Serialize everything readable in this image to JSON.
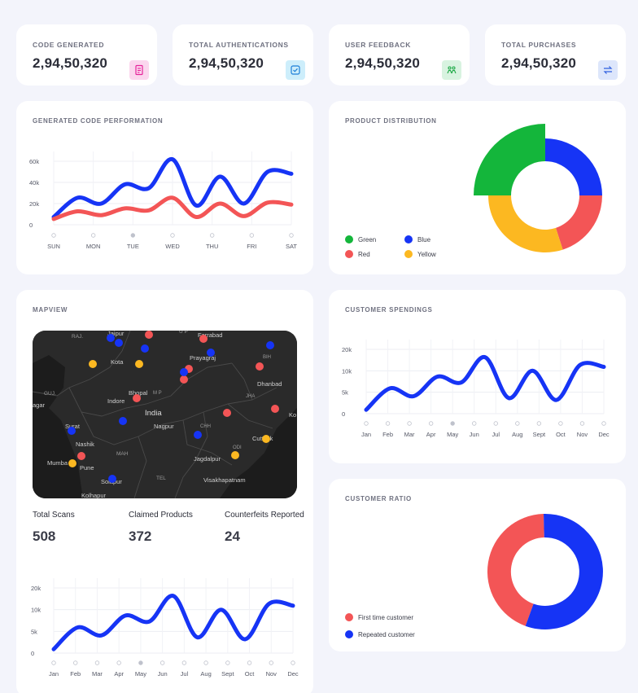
{
  "kpis": [
    {
      "label": "CODE GENERATED",
      "value": "2,94,50,320",
      "icon": "receipt-icon",
      "color": "#e6249a",
      "bg": "#fbd6ee"
    },
    {
      "label": "TOTAL AUTHENTICATIONS",
      "value": "2,94,50,320",
      "icon": "check-square-icon",
      "color": "#1c7fd8",
      "bg": "#cdeefb"
    },
    {
      "label": "USER FEEDBACK",
      "value": "2,94,50,320",
      "icon": "users-icon",
      "color": "#1ba844",
      "bg": "#d8f3e0"
    },
    {
      "label": "TOTAL  PURCHASES",
      "value": "2,94,50,320",
      "icon": "swap-arrows-icon",
      "color": "#2f5fe0",
      "bg": "#dde6fb"
    }
  ],
  "performance": {
    "title": "GENERATED CODE PERFORMATION",
    "chart_data": {
      "type": "line",
      "categories": [
        "SUN",
        "MON",
        "TUE",
        "WED",
        "THU",
        "FRI",
        "SAT"
      ],
      "y_ticks": [
        "60k",
        "40k",
        "20k",
        "0"
      ],
      "ylim": [
        0,
        60000
      ],
      "series": [
        {
          "color": "#1634f5",
          "values": [
            8000,
            28000,
            22000,
            42000,
            38000,
            68000,
            20000,
            50000,
            22000,
            55000,
            53000
          ]
        },
        {
          "color": "#f35556",
          "values": [
            6000,
            14000,
            10000,
            17000,
            15000,
            28000,
            8000,
            22000,
            9000,
            23000,
            21000
          ]
        }
      ]
    }
  },
  "distribution": {
    "title": "PRODUCT DISTRIBUTION",
    "chart_data": {
      "type": "pie",
      "labels": [
        "Green",
        "Blue",
        "Red",
        "Yellow"
      ],
      "values": [
        25,
        25,
        20,
        30
      ],
      "colors": [
        "#14b63b",
        "#1634f5",
        "#f35556",
        "#fcb821"
      ]
    }
  },
  "mapview": {
    "title": "MAPVIEW",
    "places": [
      "Jaipur",
      "Farrabad",
      "RAJ.",
      "U P",
      "Kota",
      "Prayagraj",
      "BIH",
      "Dhanbad",
      "GUJ.",
      "Bhopal",
      "M P",
      "JHA",
      "Indore",
      "India",
      "agar",
      "Surat",
      "Nagpur",
      "CHH",
      "Ko",
      "Nashik",
      "MAH",
      "Cuttack",
      "ODI",
      "Mumba",
      "Pune",
      "Jagdalpur",
      "TEL",
      "Visakhapatnam",
      "Solapur",
      "Kolhapur"
    ],
    "markers": {
      "red": "#f35556",
      "blue": "#1634f5",
      "yellow": "#fcb821"
    }
  },
  "stats": [
    {
      "label": "Total Scans",
      "value": "508"
    },
    {
      "label": "Claimed Products",
      "value": "372"
    },
    {
      "label": "Counterfeits Reported",
      "value": "24"
    }
  ],
  "monthly_chart": {
    "chart_data": {
      "type": "line",
      "categories": [
        "Jan",
        "Feb",
        "Mar",
        "Apr",
        "May",
        "Jun",
        "Jul",
        "Aug",
        "Sept",
        "Oct",
        "Nov",
        "Dec"
      ],
      "y_ticks": [
        "20k",
        "10k",
        "5k",
        "0"
      ],
      "series": [
        {
          "color": "#1634f5",
          "values": [
            2000,
            13000,
            9000,
            19000,
            16000,
            29000,
            8000,
            22000,
            7000,
            25000,
            24000
          ]
        }
      ]
    }
  },
  "spendings": {
    "title": "CUSTOMER SPENDINGS",
    "chart_data": {
      "type": "line",
      "categories": [
        "Jan",
        "Feb",
        "Mar",
        "Apr",
        "May",
        "Jun",
        "Jul",
        "Aug",
        "Sept",
        "Oct",
        "Nov",
        "Dec"
      ],
      "y_ticks": [
        "20k",
        "10k",
        "5k",
        "0"
      ],
      "series": [
        {
          "color": "#1634f5",
          "values": [
            2000,
            13000,
            9000,
            19000,
            16000,
            29000,
            8000,
            22000,
            7000,
            25000,
            24000
          ]
        }
      ]
    }
  },
  "ratio": {
    "title": "CUSTOMER RATIO",
    "chart_data": {
      "type": "pie",
      "labels": [
        "First time  customer",
        "Repeated customer"
      ],
      "values": [
        44,
        56
      ],
      "colors": [
        "#f35556",
        "#1634f5"
      ]
    }
  }
}
